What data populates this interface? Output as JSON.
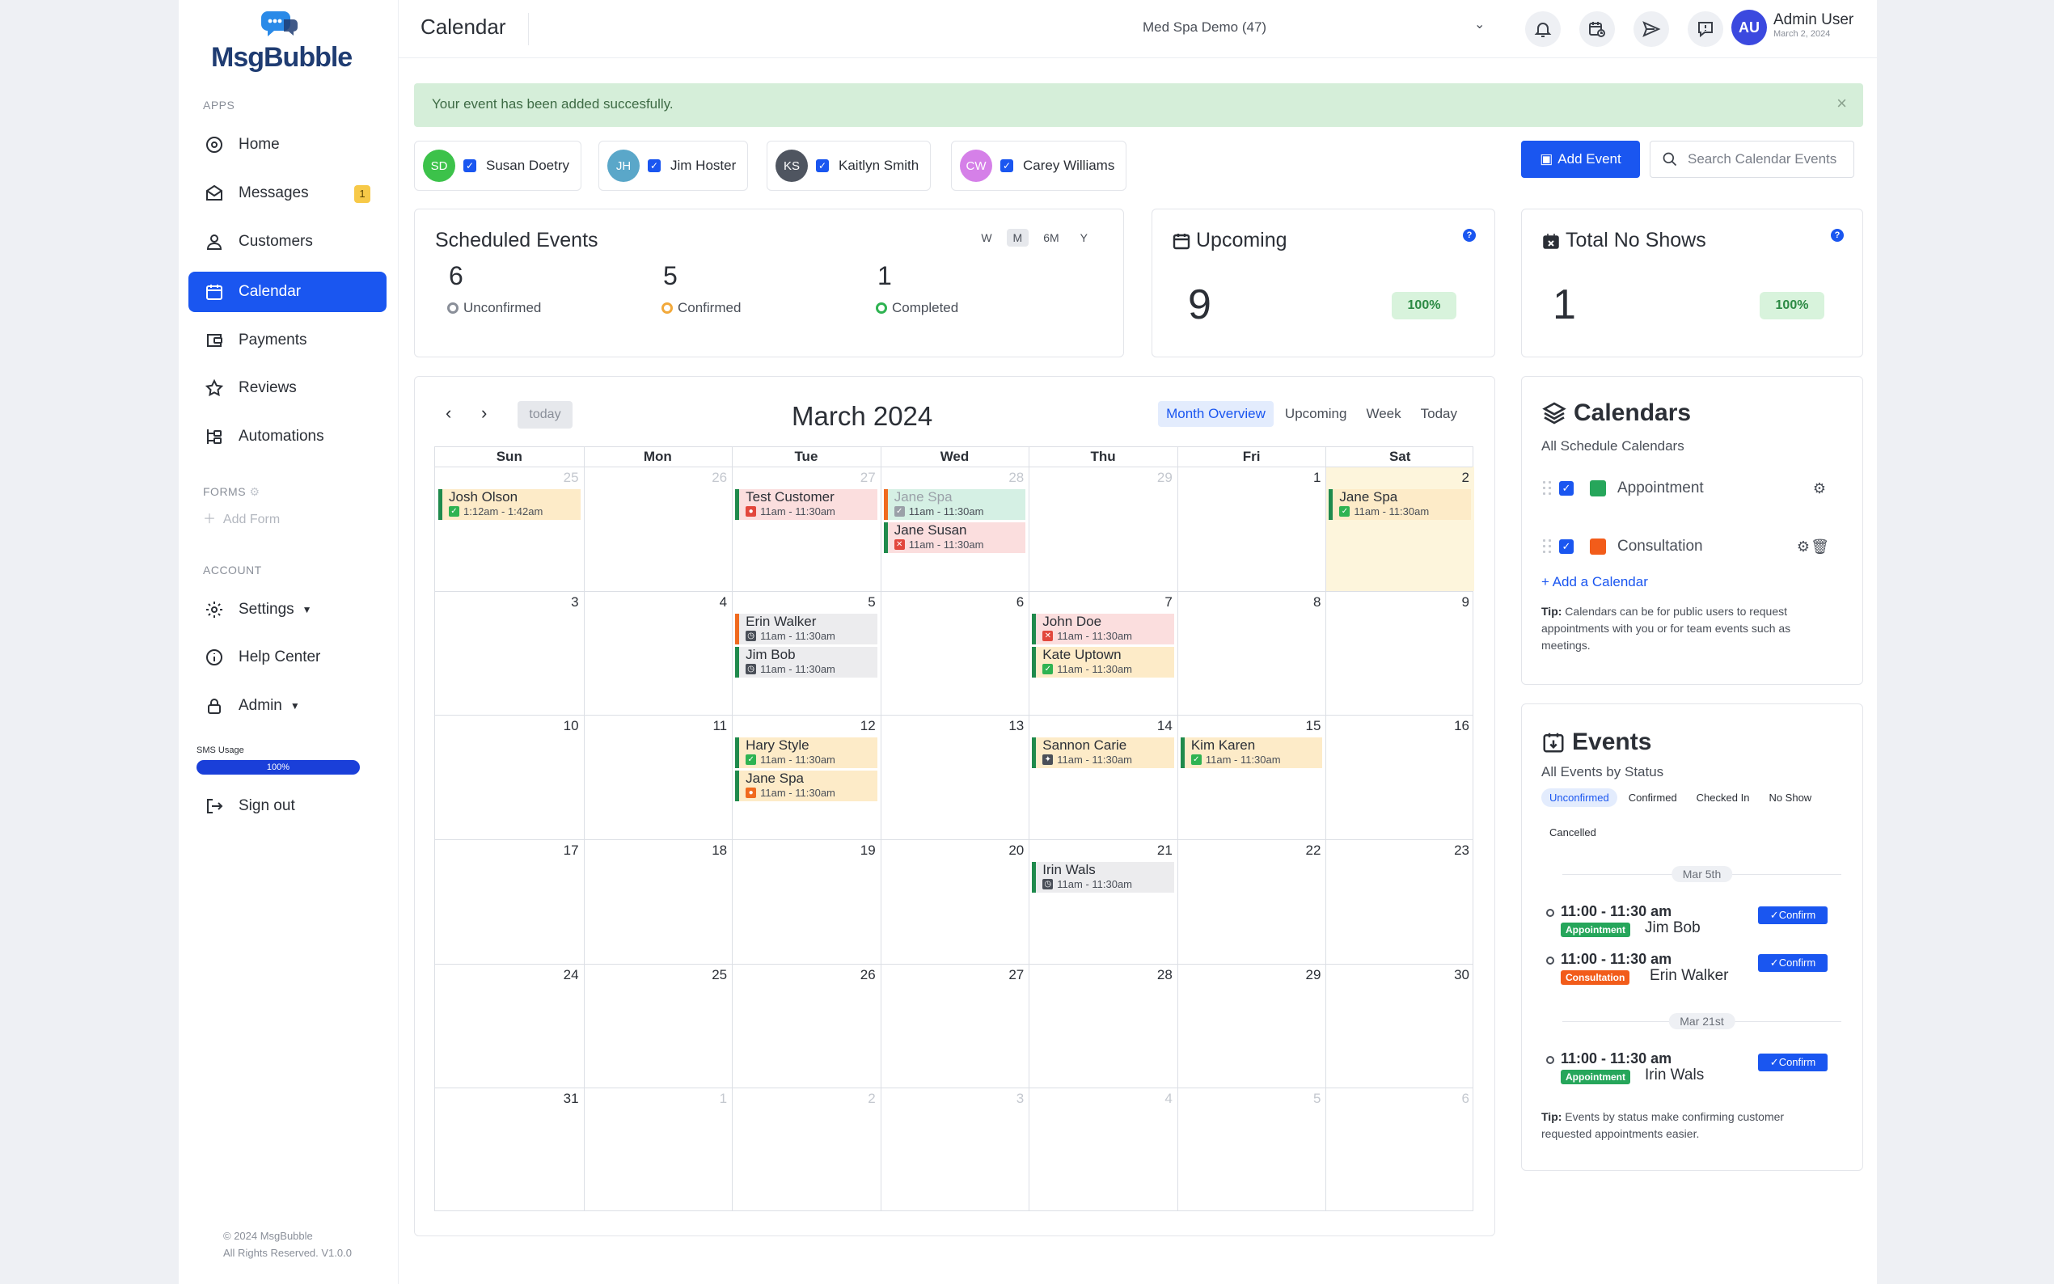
{
  "app": {
    "logo_text": "MsgBubble",
    "page_title": "Calendar",
    "account": "Med Spa Demo (47)",
    "user_name": "Admin User",
    "user_date": "March 2, 2024",
    "user_initials": "AU"
  },
  "sidebar": {
    "apps_label": "APPS",
    "forms_label": "FORMS",
    "account_label": "ACCOUNT",
    "items": [
      {
        "label": "Home",
        "icon": "home-icon"
      },
      {
        "label": "Messages",
        "icon": "messages-icon",
        "badge": "1"
      },
      {
        "label": "Customers",
        "icon": "user-icon"
      },
      {
        "label": "Calendar",
        "icon": "calendar-icon",
        "active": true
      },
      {
        "label": "Payments",
        "icon": "payments-icon"
      },
      {
        "label": "Reviews",
        "icon": "star-icon"
      },
      {
        "label": "Automations",
        "icon": "automations-icon"
      }
    ],
    "add_form": "Add Form",
    "account_items": [
      {
        "label": "Settings",
        "icon": "gear-icon"
      },
      {
        "label": "Help Center",
        "icon": "info-icon"
      },
      {
        "label": "Admin",
        "icon": "lock-icon"
      }
    ],
    "sms_label": "SMS Usage",
    "sms_value": "100%",
    "sms_fraction": 1.0,
    "sign_out": "Sign out",
    "copyright": "© 2024 MsgBubble",
    "rights": "All Rights Reserved. V1.0.0"
  },
  "alert": {
    "text": "Your event has been added succesfully.",
    "close": "×"
  },
  "staff": [
    {
      "initials": "SD",
      "name": "Susan Doetry",
      "color": "#3cc24a"
    },
    {
      "initials": "JH",
      "name": "Jim Hoster",
      "color": "#5aa7c9"
    },
    {
      "initials": "KS",
      "name": "Kaitlyn Smith",
      "color": "#4f5560"
    },
    {
      "initials": "CW",
      "name": "Carey Williams",
      "color": "#d580e8"
    }
  ],
  "toolbar": {
    "add_event": "Add Event",
    "search_placeholder": "Search Calendar Events"
  },
  "scheduled": {
    "title": "Scheduled Events",
    "ranges": [
      "W",
      "M",
      "6M",
      "Y"
    ],
    "active_range": "M",
    "stats": [
      {
        "value": "6",
        "label": "Unconfirmed",
        "color": "#8a8f99"
      },
      {
        "value": "5",
        "label": "Confirmed",
        "color": "#f2a93b"
      },
      {
        "value": "1",
        "label": "Completed",
        "color": "#2fb352"
      }
    ]
  },
  "upcoming": {
    "title": "Upcoming",
    "value": "9",
    "pct": "100%"
  },
  "noshows": {
    "title": "Total No Shows",
    "value": "1",
    "pct": "100%"
  },
  "calendar": {
    "month": "March 2024",
    "today_label": "today",
    "views": [
      "Month Overview",
      "Upcoming",
      "Week",
      "Today"
    ],
    "active_view": "Month Overview",
    "days": [
      "Sun",
      "Mon",
      "Tue",
      "Wed",
      "Thu",
      "Fri",
      "Sat"
    ],
    "weeks": [
      [
        {
          "n": "25",
          "m": true
        },
        {
          "n": "26",
          "m": true
        },
        {
          "n": "27",
          "m": true
        },
        {
          "n": "28",
          "m": true
        },
        {
          "n": "29",
          "m": true
        },
        {
          "n": "1"
        },
        {
          "n": "2",
          "today": true
        }
      ],
      [
        {
          "n": "3"
        },
        {
          "n": "4"
        },
        {
          "n": "5"
        },
        {
          "n": "6"
        },
        {
          "n": "7"
        },
        {
          "n": "8"
        },
        {
          "n": "9"
        }
      ],
      [
        {
          "n": "10"
        },
        {
          "n": "11"
        },
        {
          "n": "12"
        },
        {
          "n": "13"
        },
        {
          "n": "14"
        },
        {
          "n": "15"
        },
        {
          "n": "16"
        }
      ],
      [
        {
          "n": "17"
        },
        {
          "n": "18"
        },
        {
          "n": "19"
        },
        {
          "n": "20"
        },
        {
          "n": "21"
        },
        {
          "n": "22"
        },
        {
          "n": "23"
        }
      ],
      [
        {
          "n": "24"
        },
        {
          "n": "25"
        },
        {
          "n": "26"
        },
        {
          "n": "27"
        },
        {
          "n": "28"
        },
        {
          "n": "29"
        },
        {
          "n": "30"
        }
      ],
      [
        {
          "n": "31"
        },
        {
          "n": "1",
          "m": true
        },
        {
          "n": "2",
          "m": true
        },
        {
          "n": "3",
          "m": true
        },
        {
          "n": "4",
          "m": true
        },
        {
          "n": "5",
          "m": true
        },
        {
          "n": "6",
          "m": true
        }
      ]
    ],
    "events": [
      {
        "week": 0,
        "day": 0,
        "slot": 0,
        "title": "Josh Olson",
        "time": "1:12am - 1:42am",
        "bg": "#fdebc8",
        "bar": "#1f8a4c",
        "icon": "check",
        "iconColor": "#2fb352"
      },
      {
        "week": 0,
        "day": 2,
        "slot": 0,
        "title": "Test Customer",
        "time": "11am - 11:30am",
        "bg": "#fbdede",
        "bar": "#1f8a4c",
        "icon": "person",
        "iconColor": "#e2473d"
      },
      {
        "week": 0,
        "day": 3,
        "slot": 0,
        "title": "Jane Spa",
        "time": "11am - 11:30am",
        "bg": "#d5f0e4",
        "bar": "#f06a1f",
        "icon": "check",
        "iconColor": "#9aa0a8",
        "faded": true
      },
      {
        "week": 0,
        "day": 3,
        "slot": 1,
        "title": "Jane Susan",
        "time": "11am - 11:30am",
        "bg": "#fbdede",
        "bar": "#1f8a4c",
        "icon": "x",
        "iconColor": "#e2473d"
      },
      {
        "week": 0,
        "day": 6,
        "slot": 0,
        "title": "Jane Spa",
        "time": "11am - 11:30am",
        "bg": "#fdebc8",
        "bar": "#1f8a4c",
        "icon": "check",
        "iconColor": "#2fb352"
      },
      {
        "week": 1,
        "day": 2,
        "slot": 0,
        "title": "Erin Walker",
        "time": "11am - 11:30am",
        "bg": "#ececee",
        "bar": "#f06a1f",
        "icon": "clock",
        "iconColor": "#4a4f58"
      },
      {
        "week": 1,
        "day": 2,
        "slot": 1,
        "title": "Jim Bob",
        "time": "11am - 11:30am",
        "bg": "#ececee",
        "bar": "#1f8a4c",
        "icon": "clock",
        "iconColor": "#4a4f58"
      },
      {
        "week": 1,
        "day": 4,
        "slot": 0,
        "title": "John Doe",
        "time": "11am - 11:30am",
        "bg": "#fbdede",
        "bar": "#1f8a4c",
        "icon": "x",
        "iconColor": "#e2473d"
      },
      {
        "week": 1,
        "day": 4,
        "slot": 1,
        "title": "Kate Uptown",
        "time": "11am - 11:30am",
        "bg": "#fdebc8",
        "bar": "#1f8a4c",
        "icon": "check",
        "iconColor": "#2fb352"
      },
      {
        "week": 2,
        "day": 2,
        "slot": 0,
        "title": "Hary Style",
        "time": "11am - 11:30am",
        "bg": "#fdebc8",
        "bar": "#1f8a4c",
        "icon": "check",
        "iconColor": "#2fb352"
      },
      {
        "week": 2,
        "day": 2,
        "slot": 1,
        "title": "Jane Spa",
        "time": "11am - 11:30am",
        "bg": "#fdebc8",
        "bar": "#1f8a4c",
        "icon": "circle",
        "iconColor": "#f06a1f"
      },
      {
        "week": 2,
        "day": 4,
        "slot": 0,
        "title": "Sannon Carie",
        "time": "11am - 11:30am",
        "bg": "#fdebc8",
        "bar": "#1f8a4c",
        "icon": "walk",
        "iconColor": "#4a4f58"
      },
      {
        "week": 2,
        "day": 5,
        "slot": 0,
        "title": "Kim Karen",
        "time": "11am - 11:30am",
        "bg": "#fdebc8",
        "bar": "#1f8a4c",
        "icon": "check",
        "iconColor": "#2fb352"
      },
      {
        "week": 3,
        "day": 4,
        "slot": 0,
        "title": "Irin Wals",
        "time": "11am - 11:30am",
        "bg": "#ececee",
        "bar": "#1f8a4c",
        "icon": "clock",
        "iconColor": "#4a4f58"
      }
    ]
  },
  "calendars_panel": {
    "title": "Calendars",
    "subtitle": "All Schedule Calendars",
    "items": [
      {
        "name": "Appointment",
        "color": "#26a65b",
        "deletable": false
      },
      {
        "name": "Consultation",
        "color": "#f25c1a",
        "deletable": true
      }
    ],
    "add_label": "+ Add a Calendar",
    "tip_label": "Tip:",
    "tip_text": "Calendars can be for public users to request appointments with you or for team events such as meetings."
  },
  "events_panel": {
    "title": "Events",
    "subtitle": "All Events by Status",
    "tabs": [
      "Unconfirmed",
      "Confirmed",
      "Checked In",
      "No Show",
      "Cancelled"
    ],
    "active_tab": "Unconfirmed",
    "groups": [
      {
        "date": "Mar 5th",
        "events": [
          {
            "time": "11:00 - 11:30 am",
            "tag": "Appointment",
            "tag_color": "#26a65b",
            "name": "Jim Bob",
            "action": "Confirm"
          },
          {
            "time": "11:00 - 11:30 am",
            "tag": "Consultation",
            "tag_color": "#f25c1a",
            "name": "Erin Walker",
            "action": "Confirm"
          }
        ]
      },
      {
        "date": "Mar 21st",
        "events": [
          {
            "time": "11:00 - 11:30 am",
            "tag": "Appointment",
            "tag_color": "#26a65b",
            "name": "Irin Wals",
            "action": "Confirm"
          }
        ]
      }
    ],
    "tip_label": "Tip:",
    "tip_text": "Events by status make confirming customer requested appointments easier."
  }
}
